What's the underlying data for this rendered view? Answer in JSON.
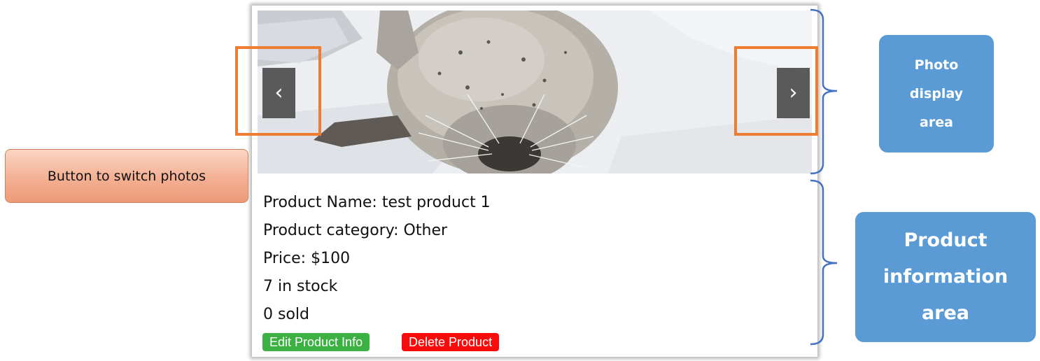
{
  "product": {
    "name_line": "Product Name: test product 1",
    "category_line": "Product category: Other",
    "price_line": "Price: $100",
    "stock_line": "7 in stock",
    "sold_line": "0 sold"
  },
  "carousel": {
    "prev_label": "‹",
    "next_label": "›"
  },
  "actions": {
    "edit_label": "Edit Product Info",
    "delete_label": "Delete Product"
  },
  "annotations": {
    "switch_photos": "Button to switch photos",
    "photo_area": [
      "Photo",
      "display",
      "area"
    ],
    "info_area": [
      "Product",
      "information",
      "area"
    ]
  },
  "colors": {
    "highlight_orange": "#ef7d31",
    "callout_blue": "#5b9bd5",
    "brace_blue": "#4472c4",
    "edit_green": "#3cb043",
    "delete_red": "#f80b0b"
  }
}
